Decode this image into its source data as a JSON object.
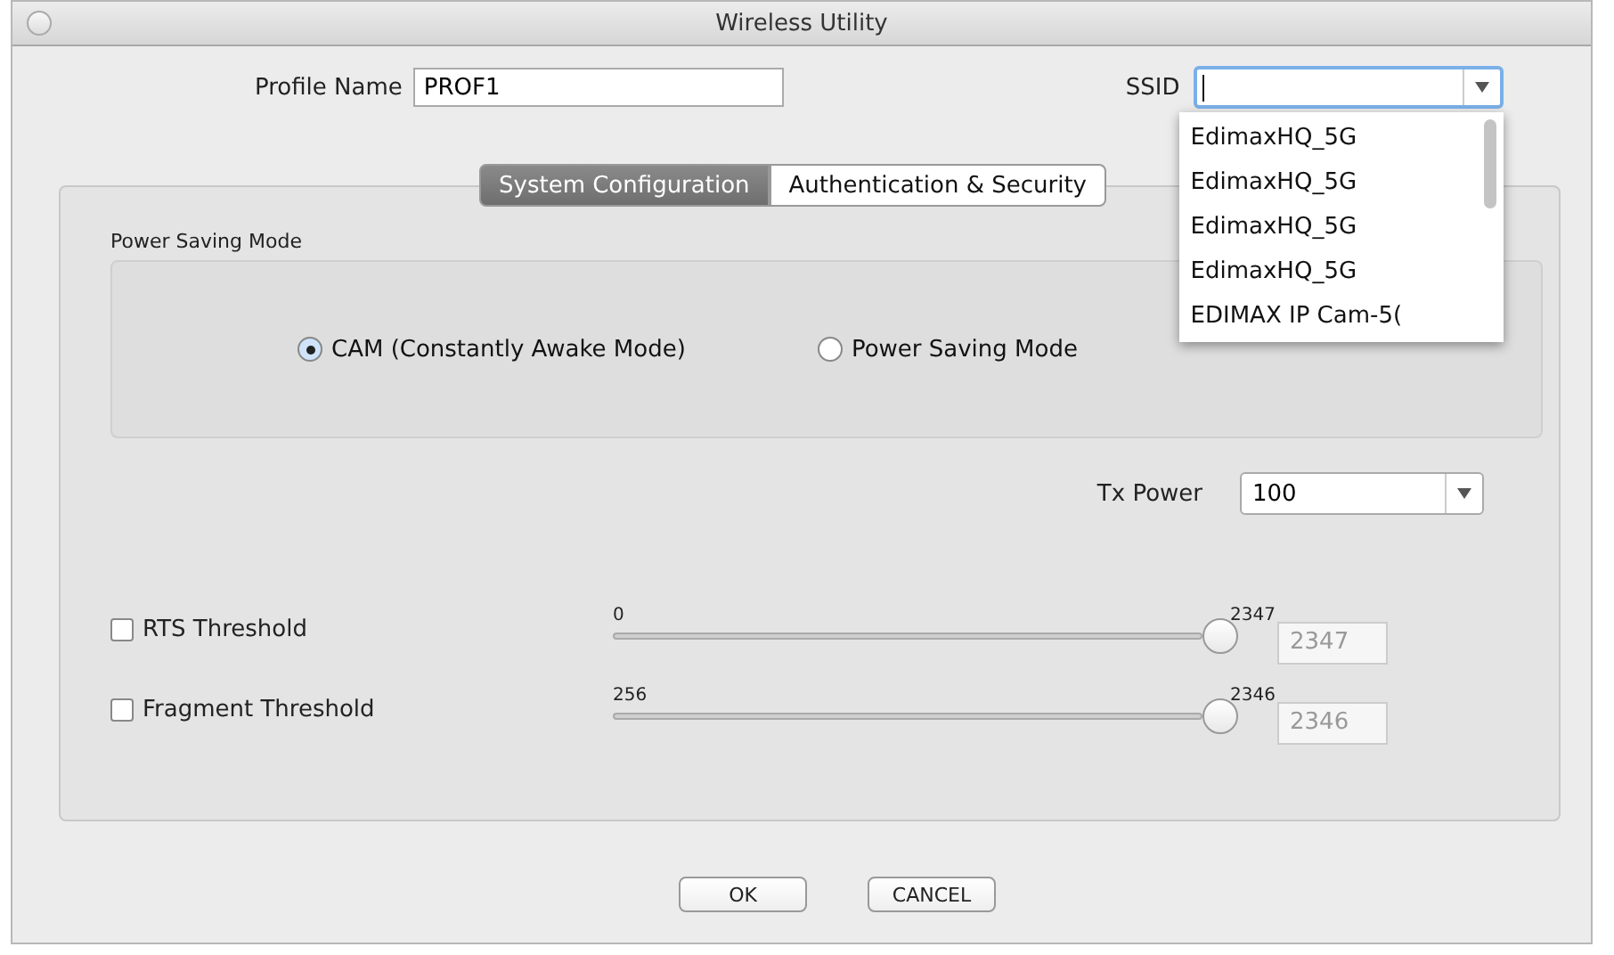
{
  "window": {
    "title": "Wireless Utility"
  },
  "profile_name": {
    "label": "Profile Name",
    "value": "PROF1"
  },
  "ssid": {
    "label": "SSID",
    "expanded": true,
    "options": [
      "EdimaxHQ_5G",
      "EdimaxHQ_5G",
      "EdimaxHQ_5G",
      "EdimaxHQ_5G",
      "EDIMAX IP Cam-5("
    ]
  },
  "tabs": [
    {
      "label": "System Configuration",
      "selected": true
    },
    {
      "label": "Authentication & Security",
      "selected": false
    }
  ],
  "power_saving": {
    "title": "Power Saving Mode",
    "options": [
      {
        "label": "CAM (Constantly Awake Mode)",
        "selected": true
      },
      {
        "label": "Power Saving Mode",
        "selected": false
      }
    ]
  },
  "tx_power": {
    "label": "Tx Power",
    "value": "100"
  },
  "thresholds": [
    {
      "label": "RTS Threshold",
      "checked": false,
      "min": "0",
      "max": "2347",
      "level": 1,
      "value": "2347",
      "field_disabled": true
    },
    {
      "label": "Fragment Threshold",
      "checked": false,
      "min": "256",
      "max": "2346",
      "level": 1,
      "value": "2346",
      "field_disabled": true
    }
  ],
  "buttons": [
    "OK",
    "CANCEL"
  ]
}
